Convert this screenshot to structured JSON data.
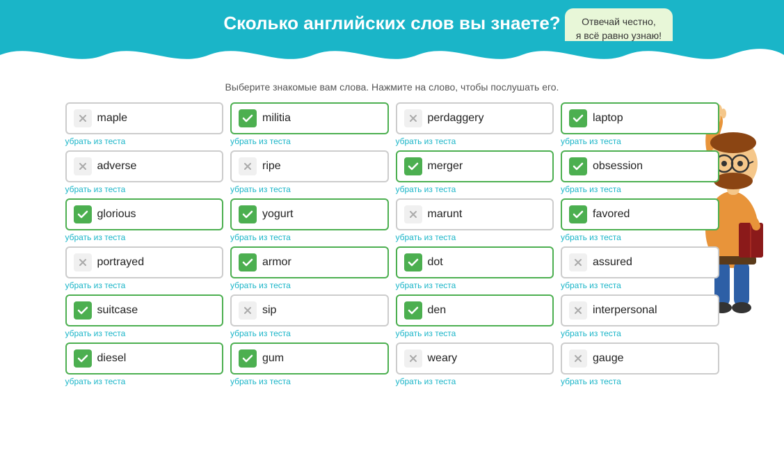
{
  "header": {
    "title": "Сколько английских слов вы знаете?",
    "bubble_line1": "Отвечай честно,",
    "bubble_line2": "я всё равно узнаю!"
  },
  "subtitle": "Выберите знакомые вам слова. Нажмите на слово, чтобы послушать его.",
  "remove_label": "убрать из теста",
  "words": [
    {
      "word": "maple",
      "checked": false
    },
    {
      "word": "militia",
      "checked": true
    },
    {
      "word": "perdaggery",
      "checked": false
    },
    {
      "word": "laptop",
      "checked": true
    },
    {
      "word": "adverse",
      "checked": false
    },
    {
      "word": "ripe",
      "checked": false
    },
    {
      "word": "merger",
      "checked": true
    },
    {
      "word": "obsession",
      "checked": true
    },
    {
      "word": "glorious",
      "checked": true
    },
    {
      "word": "yogurt",
      "checked": true
    },
    {
      "word": "marunt",
      "checked": false
    },
    {
      "word": "favored",
      "checked": true
    },
    {
      "word": "portrayed",
      "checked": false
    },
    {
      "word": "armor",
      "checked": true
    },
    {
      "word": "dot",
      "checked": true
    },
    {
      "word": "assured",
      "checked": false
    },
    {
      "word": "suitcase",
      "checked": true
    },
    {
      "word": "sip",
      "checked": false
    },
    {
      "word": "den",
      "checked": true
    },
    {
      "word": "interpersonal",
      "checked": false
    },
    {
      "word": "diesel",
      "checked": true
    },
    {
      "word": "gum",
      "checked": true
    },
    {
      "word": "weary",
      "checked": false
    },
    {
      "word": "gauge",
      "checked": false
    }
  ]
}
